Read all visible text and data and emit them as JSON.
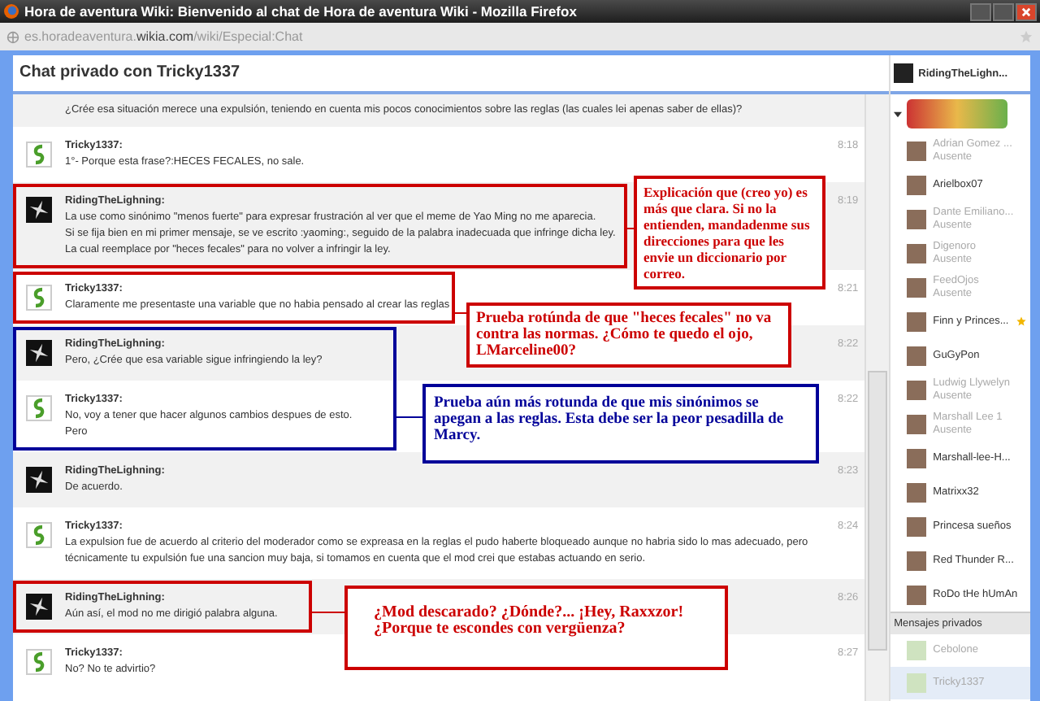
{
  "window": {
    "title": "Hora de aventura Wiki: Bienvenido al chat de Hora de aventura Wiki - Mozilla Firefox"
  },
  "address_bar": {
    "url": "es.horadeaventura.**wikia.com**/wiki/Especial:Chat"
  },
  "chat": {
    "title": "Chat privado con Tricky1337",
    "messages": [
      {
        "kind": "continuation",
        "text": "¿Crée esa situación merece una expulsión, teniendo en cuenta mis pocos conocimientos sobre las reglas (las cuales lei apenas saber de ellas)?",
        "shaded": true
      },
      {
        "kind": "swirl",
        "user": "Tricky1337:",
        "text": "1°- Porque esta frase?:HECES FECALES, no sale.",
        "time": "8:18",
        "shaded": false
      },
      {
        "kind": "shuriken",
        "user": "RidingTheLighning:",
        "text": "La use como sinónimo \"menos fuerte\" para expresar frustración al ver que el meme de Yao Ming no me aparecia.\nSi se fija bien en mi primer mensaje, se ve escrito :yaoming:, seguido de la palabra inadecuada que infringe dicha ley.\nLa cual reemplace por \"heces fecales\" para no volver a infringir la ley.",
        "time": "8:19",
        "shaded": true
      },
      {
        "kind": "swirl",
        "user": "Tricky1337:",
        "text": "Claramente me presentaste una variable que no habia pensado al crear las reglas",
        "time": "8:21",
        "shaded": false
      },
      {
        "kind": "shuriken",
        "user": "RidingTheLighning:",
        "text": "Pero, ¿Crée que esa variable sigue infringiendo la ley?",
        "time": "8:22",
        "shaded": true
      },
      {
        "kind": "swirl",
        "user": "Tricky1337:",
        "text": "No, voy a tener que hacer algunos cambios despues de esto.\nPero",
        "time": "8:22",
        "shaded": false
      },
      {
        "kind": "shuriken",
        "user": "RidingTheLighning:",
        "text": "De acuerdo.",
        "time": "8:23",
        "shaded": true
      },
      {
        "kind": "swirl",
        "user": "Tricky1337:",
        "text": "La expulsion fue de acuerdo al criterio del moderador como se expreasa en la reglas el pudo haberte bloqueado aunque no habria sido lo mas adecuado, pero técnicamente tu expulsión fue una sancion muy baja, si tomamos en cuenta que el mod crei que estabas actuando en serio.",
        "time": "8:24",
        "shaded": false
      },
      {
        "kind": "shuriken",
        "user": "RidingTheLighning:",
        "text": "Aún así, el mod no me dirigió palabra alguna.",
        "time": "8:26",
        "shaded": true
      },
      {
        "kind": "swirl",
        "user": "Tricky1337:",
        "text": "No? No te advirtio?",
        "time": "8:27",
        "shaded": false
      }
    ],
    "annotations": [
      {
        "text": "Explicación que (creo yo) es más que clara. Si no la entienden, mandadenme sus direcciones para que les envie un diccionario por correo.",
        "color": "#cc0000"
      },
      {
        "text": "Prueba rotúnda de que \"heces fecales\" no va contra las normas. ¿Cómo te quedo el ojo, LMarceline00?",
        "color": "#cc0000"
      },
      {
        "text": "Prueba aún más rotunda de que mis sinónimos se apegan a las reglas. Esta debe ser la peor pesadilla de Marcy.",
        "color": "#000099"
      },
      {
        "text": "¿Mod descarado? ¿Dónde?... ¡Hey, Raxxzor! ¿Porque te escondes con vergüenza?",
        "color": "#cc0000"
      }
    ]
  },
  "sidebar": {
    "current_user": "RidingTheLighn...",
    "users": [
      {
        "name": "Adrian Gomez ...",
        "status": "Ausente",
        "away": true,
        "starred": false
      },
      {
        "name": "Arielbox07",
        "away": false,
        "starred": false
      },
      {
        "name": "Dante Emiliano...",
        "status": "Ausente",
        "away": true,
        "starred": false
      },
      {
        "name": "Digenoro",
        "status": "Ausente",
        "away": true,
        "starred": false
      },
      {
        "name": "FeedOjos",
        "status": "Ausente",
        "away": true,
        "starred": false
      },
      {
        "name": "Finn y Princes...",
        "away": false,
        "starred": true
      },
      {
        "name": "GuGyPon",
        "away": false,
        "starred": false
      },
      {
        "name": "Ludwig Llywelyn",
        "status": "Ausente",
        "away": true,
        "starred": false
      },
      {
        "name": "Marshall Lee 1",
        "status": "Ausente",
        "away": true,
        "starred": false
      },
      {
        "name": "Marshall-lee-H...",
        "away": false,
        "starred": false
      },
      {
        "name": "Matrixx32",
        "away": false,
        "starred": false
      },
      {
        "name": "Princesa sueños",
        "away": false,
        "starred": false
      },
      {
        "name": "Red Thunder R...",
        "away": false,
        "starred": false
      },
      {
        "name": "RoDo tHe hUmAn",
        "away": false,
        "starred": false
      }
    ],
    "private_header": "Mensajes privados",
    "private": [
      {
        "name": "Cebolone",
        "away": true,
        "selected": false
      },
      {
        "name": "Tricky1337",
        "away": true,
        "selected": true
      }
    ]
  }
}
